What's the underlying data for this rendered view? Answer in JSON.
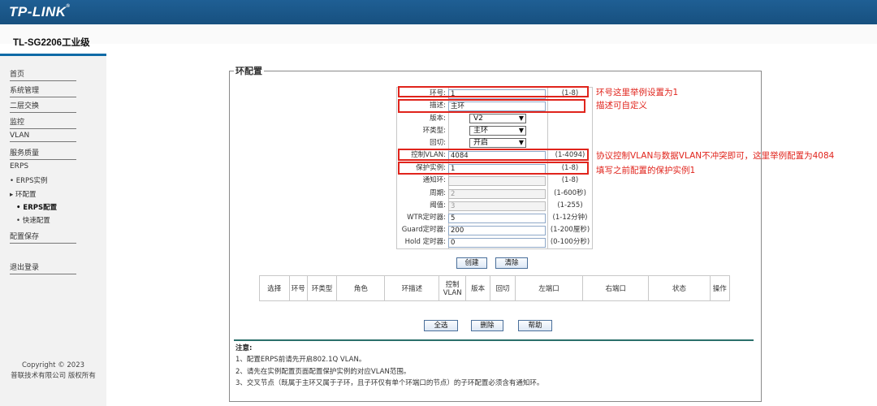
{
  "header": {
    "logo": "TP-LINK",
    "logo_mark": "®",
    "model": "TL-SG2206工业级"
  },
  "sidebar": {
    "items": [
      "首页",
      "系统管理",
      "二层交换",
      "监控",
      "VLAN",
      "服务质量",
      "ERPS"
    ],
    "erps_sub": [
      "• ERPS实例",
      "▸ 环配置",
      "• ERPS配置",
      "• 快速配置"
    ],
    "save": "配置保存",
    "logout": "退出登录",
    "copyright_line1": "Copyright © 2023",
    "copyright_line2": "普联技术有限公司 版权所有"
  },
  "panel": {
    "title": "环配置"
  },
  "form": {
    "ring_id": {
      "label": "环号:",
      "value": "1",
      "range": "(1-8)"
    },
    "desc": {
      "label": "描述:",
      "value": "主环"
    },
    "version": {
      "label": "版本:",
      "value": "V2"
    },
    "ring_type": {
      "label": "环类型:",
      "value": "主环"
    },
    "revertive": {
      "label": "回切:",
      "value": "开启"
    },
    "ctrl_vlan": {
      "label": "控制VLAN:",
      "value": "4084",
      "range": "(1-4094)"
    },
    "instance": {
      "label": "保护实例:",
      "value": "1",
      "range": "(1-8)"
    },
    "notify_ring": {
      "label": "通知环:",
      "value": "",
      "range": "(1-8)"
    },
    "period": {
      "label": "周期:",
      "value": "2",
      "range": "(1-600秒)"
    },
    "threshold": {
      "label": "阈值:",
      "value": "3",
      "range": "(1-255)"
    },
    "wtr": {
      "label": "WTR定时器:",
      "value": "5",
      "range": "(1-12分钟)"
    },
    "guard": {
      "label": "Guard定时器:",
      "value": "200",
      "range": "(1-200厘秒)"
    },
    "hold": {
      "label": "Hold 定时器:",
      "value": "0",
      "range": "(0-100分秒)"
    },
    "create_btn": "创建",
    "clear_btn": "清除"
  },
  "annotations": {
    "ring_id": "环号这里举例设置为1",
    "desc": "描述可自定义",
    "ctrl_vlan": "协议控制VLAN与数据VLAN不冲突即可，这里举例配置为4084",
    "instance": "填写之前配置的保护实例1"
  },
  "table": {
    "headers": [
      "选择",
      "环号",
      "环类型",
      "角色",
      "环描述",
      "控制VLAN",
      "版本",
      "回切",
      "左端口",
      "右端口",
      "状态",
      "操作"
    ]
  },
  "actions": {
    "select_all": "全选",
    "delete": "删除",
    "help": "帮助"
  },
  "notes": {
    "title": "注意:",
    "items": [
      "1、配置ERPS前请先开启802.1Q VLAN。",
      "2、请先在实例配置页面配置保护实例的对应VLAN范围。",
      "3、交叉节点（既属于主环又属于子环，且子环仅有单个环端口的节点）的子环配置必须含有通知环。"
    ]
  },
  "colors": {
    "topbar": "#1f5f94",
    "highlight": "#e0241c",
    "accent": "#0e6aa6"
  }
}
